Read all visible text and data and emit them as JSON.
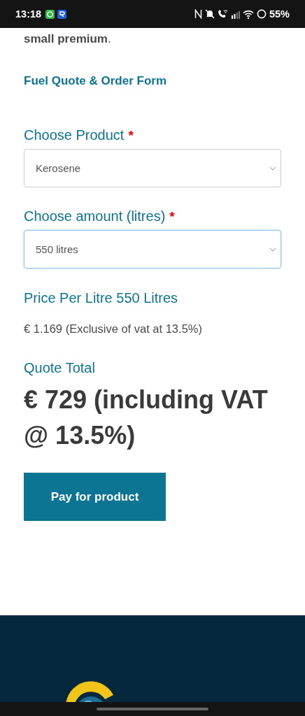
{
  "status_bar": {
    "time": "13:18",
    "battery": "55%"
  },
  "intro_tail": "small premium",
  "intro_end": ".",
  "form_title": "Fuel Quote & Order Form",
  "fields": [
    {
      "label": "Choose Product",
      "required_mark": "*",
      "value": "Kerosene",
      "focused": false
    },
    {
      "label": "Choose amount (litres)",
      "required_mark": "*",
      "value": "550 litres",
      "focused": true
    }
  ],
  "price_label": "Price Per Litre 550 Litres",
  "price_value": "€ 1.169 (Exclusive of vat at 13.5%)",
  "quote_label": "Quote Total",
  "quote_total": "€ 729 (including VAT @ 13.5%)",
  "pay_button": "Pay for product"
}
